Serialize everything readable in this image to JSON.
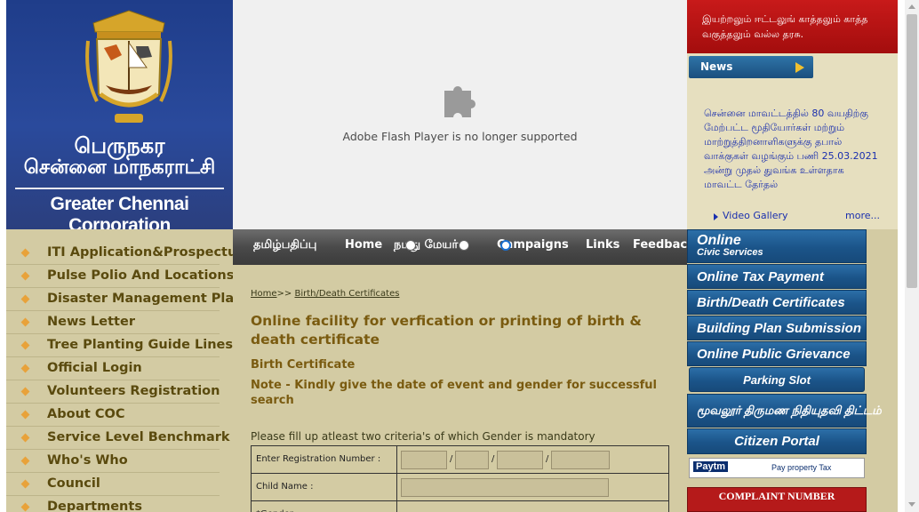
{
  "logo": {
    "tamil_line1": "பெருநகர",
    "tamil_line2": "சென்னை மாநகராட்சி",
    "english": "Greater Chennai Corporation"
  },
  "left_nav": [
    "ITI Application&Prospectus",
    "Pulse Polio And Locations",
    "Disaster Management Plan",
    "News Letter",
    "Tree Planting Guide Lines",
    "Official Login",
    "Volunteers Registration",
    "About COC",
    "Service Level Benchmark",
    "Who's Who",
    "Council",
    "Departments"
  ],
  "flash": {
    "message": "Adobe Flash Player is no longer supported"
  },
  "top_nav": [
    "தமிழ்பதிப்பு",
    "Home",
    "நமது மேயர்",
    "Campaigns",
    "Links",
    "Feedback"
  ],
  "breadcrumb": {
    "home": "Home",
    "sep": ">>",
    "current": "Birth/Death Certificates"
  },
  "main": {
    "title": "Online facility for verfication or printing of birth & death certificate",
    "subtitle": "Birth Certificate",
    "note": "Note - Kindly give the date of event and gender for successful search",
    "instruction": "Please fill up atleast two criteria's of which Gender is mandatory"
  },
  "form": {
    "reg_label": "Enter Registration Number :",
    "child_label": "Child Name :",
    "gender_label": "*Gender :",
    "slash": "/"
  },
  "right": {
    "banner": "இயற்றலும் ஈட்டலுங் காத்தலும் காத்த வகுத்தலும் வல்ல தரசு.",
    "news_label": "News",
    "news_text": "சென்னை மாவட்டத்தில் 80 வயதிற்கு மேற்பட்ட மூதியோர்கள் மற்றும் மாற்றுத்திறனாளிகளுக்கு தபால் வாக்குகள் வழங்கும் பணி 25.03.2021 அன்று முதல் துவங்க உள்ளதாக மாவட்ட தேர்தல்",
    "video_gallery": "Video Gallery",
    "more": "more..."
  },
  "services": [
    {
      "line1": "Online",
      "line2": "Civic Services"
    },
    "Online Tax Payment",
    "Birth/Death Certificates",
    "Building Plan Submission",
    "Online Public Grievance",
    "Parking Slot",
    "மூவலூர் திருமண நிதியுதவி திட்டம்",
    "Citizen Portal",
    {
      "brand": "Paytm",
      "text": "Pay property Tax"
    },
    "COMPLAINT NUMBER"
  ],
  "colors": {
    "beige": "#d3cba3",
    "heading_brown": "#7a5b10",
    "link_blue": "#1a2fae",
    "button_blue": "#1b5489",
    "banner_red": "#b31313"
  }
}
